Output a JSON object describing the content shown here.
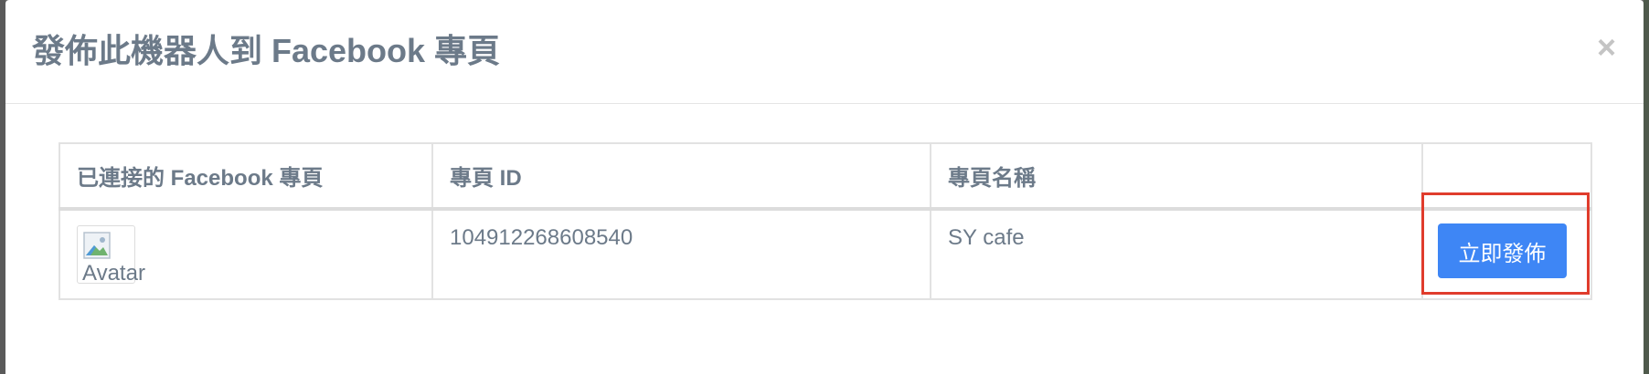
{
  "modal": {
    "title": "發佈此機器人到 Facebook 專頁",
    "close_glyph": "×"
  },
  "table": {
    "headers": [
      "已連接的 Facebook 專頁",
      "專頁 ID",
      "專頁名稱",
      ""
    ],
    "rows": [
      {
        "avatar_alt": "Avatar",
        "page_id": "104912268608540",
        "page_name": "SY cafe",
        "action_label": "立即發佈"
      }
    ]
  },
  "colors": {
    "primary_button": "#3e86f5",
    "highlight": "#e03c2c",
    "text": "#6c7a89"
  }
}
